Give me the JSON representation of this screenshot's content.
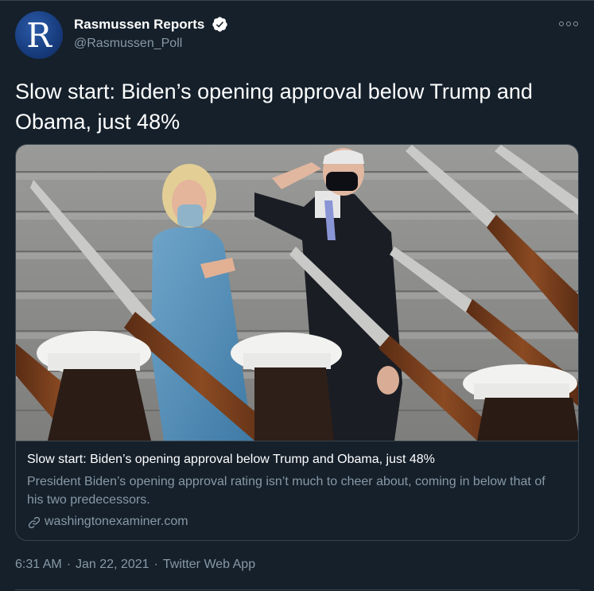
{
  "account": {
    "display_name": "Rasmussen Reports",
    "handle": "@Rasmussen_Poll",
    "avatar_letter": "R",
    "verified": true
  },
  "tweet": {
    "text": "Slow start: Biden’s opening approval below Trump and Obama, just 48%"
  },
  "card": {
    "title": "Slow start: Biden’s opening approval below Trump and Obama, just 48%",
    "description": "President Biden’s opening approval rating isn’t much to cheer about, coming in below that of his two predecessors.",
    "domain": "washingtonexaminer.com",
    "image_icon": "inauguration-photo"
  },
  "meta": {
    "time": "6:31 AM",
    "date": "Jan 22, 2021",
    "source": "Twitter Web App",
    "separator": "·"
  },
  "colors": {
    "background": "#15202b",
    "text": "#ffffff",
    "secondary": "#8899a6",
    "border": "#38444d",
    "verified": "#ffffff"
  },
  "icons": {
    "verified": "verified-badge-icon",
    "more": "more-options-icon",
    "link": "link-icon"
  }
}
